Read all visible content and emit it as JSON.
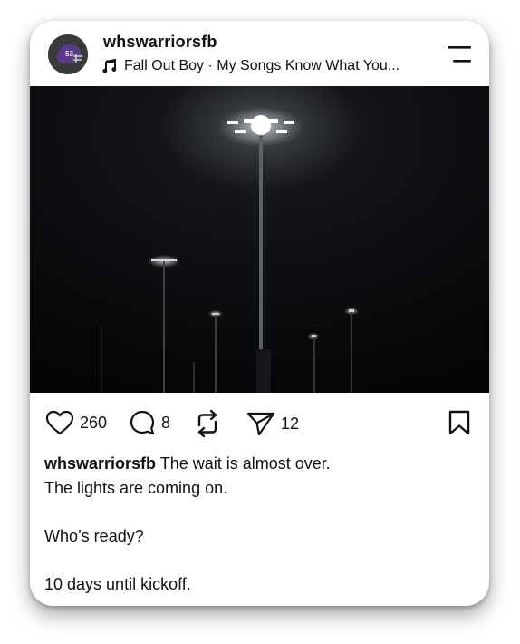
{
  "post": {
    "username": "whswarriorsfb",
    "music": "Fall Out Boy · My Songs Know What You...",
    "avatar_text": "53"
  },
  "actions": {
    "likes": "260",
    "comments": "8",
    "shares": "12"
  },
  "caption": {
    "username": "whswarriorsfb",
    "line1": "The wait is almost over.",
    "line2": "The lights are coming on.",
    "line3": "Who’s ready?",
    "line4": "10 days until kickoff."
  },
  "icons": [
    "avatar-helmet-icon",
    "music-note-icon",
    "menu-icon",
    "heart-icon",
    "comment-icon",
    "repost-icon",
    "send-icon",
    "bookmark-icon"
  ]
}
